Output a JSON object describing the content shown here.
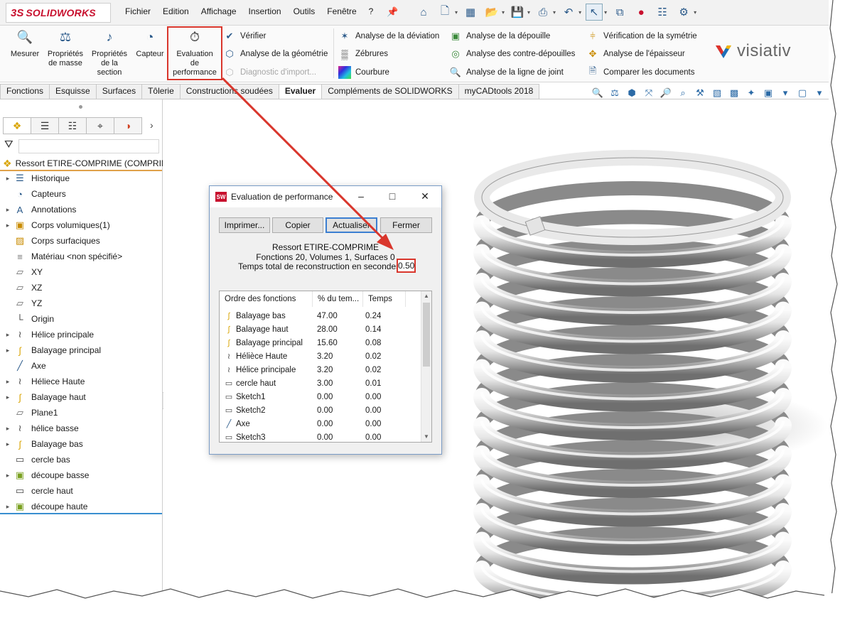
{
  "app": {
    "brand_prefix": "3S",
    "brand": "SOLIDWORKS",
    "menu": [
      "Fichier",
      "Edition",
      "Affichage",
      "Insertion",
      "Outils",
      "Fenêtre",
      "?"
    ]
  },
  "ribbon": {
    "mesurer": [
      "Mesurer"
    ],
    "proprietes_masse": [
      "Propriétés",
      "de masse"
    ],
    "proprietes_section": [
      "Propriétés",
      "de la",
      "section"
    ],
    "capteur": [
      "Capteur"
    ],
    "evaluation": [
      "Evaluation",
      "de",
      "performance"
    ],
    "verifier": "Vérifier",
    "analyse_geometrie": "Analyse de la géométrie",
    "diagnostic": "Diagnostic d'import...",
    "analyse_deviation": "Analyse de la déviation",
    "zebrures": "Zébrures",
    "courbure": "Courbure",
    "analyse_depouille": "Analyse de la dépouille",
    "analyse_contre_depouilles": "Analyse des contre-dépouilles",
    "analyse_ligne_joint": "Analyse de la ligne de joint",
    "verification_symetrie": "Vérification de la symétrie",
    "analyse_epaisseur": "Analyse de l'épaisseur",
    "comparer_documents": "Comparer les documents",
    "visiativ": "visiativ"
  },
  "tabs": [
    "Fonctions",
    "Esquisse",
    "Surfaces",
    "Tôlerie",
    "Constructions soudées",
    "Evaluer",
    "Compléments de SOLIDWORKS",
    "myCADtools 2018"
  ],
  "active_tab": "Evaluer",
  "tree": {
    "root": "Ressort ETIRE-COMPRIME  (COMPRIM",
    "items": [
      {
        "label": "Historique",
        "icon": "history-icon",
        "exp": true
      },
      {
        "label": "Capteurs",
        "icon": "sensor-icon",
        "exp": false
      },
      {
        "label": "Annotations",
        "icon": "annotation-icon",
        "exp": true
      },
      {
        "label": "Corps volumiques(1)",
        "icon": "solid-bodies-icon",
        "exp": true
      },
      {
        "label": "Corps surfaciques",
        "icon": "surface-bodies-icon",
        "exp": false
      },
      {
        "label": "Matériau <non spécifié>",
        "icon": "material-icon",
        "exp": false
      },
      {
        "label": "XY",
        "icon": "plane-icon",
        "exp": false
      },
      {
        "label": "XZ",
        "icon": "plane-icon",
        "exp": false
      },
      {
        "label": "YZ",
        "icon": "plane-icon",
        "exp": false
      },
      {
        "label": "Origin",
        "icon": "origin-icon",
        "exp": false
      },
      {
        "label": "Hélice principale",
        "icon": "helix-icon",
        "exp": true
      },
      {
        "label": "Balayage principal",
        "icon": "sweep-icon",
        "exp": true
      },
      {
        "label": "Axe",
        "icon": "axis-icon",
        "exp": false
      },
      {
        "label": "Héliece Haute",
        "icon": "helix-icon",
        "exp": true
      },
      {
        "label": "Balayage haut",
        "icon": "sweep-icon",
        "exp": true
      },
      {
        "label": "Plane1",
        "icon": "plane-icon",
        "exp": false
      },
      {
        "label": "hélice basse",
        "icon": "helix-icon",
        "exp": true
      },
      {
        "label": "Balayage bas",
        "icon": "sweep-icon",
        "exp": true
      },
      {
        "label": "cercle bas",
        "icon": "sketch-icon",
        "exp": false
      },
      {
        "label": "découpe basse",
        "icon": "cut-icon",
        "exp": true
      },
      {
        "label": "cercle haut",
        "icon": "sketch-icon",
        "exp": false
      },
      {
        "label": "découpe haute",
        "icon": "cut-icon",
        "exp": true
      }
    ]
  },
  "dialog": {
    "title": "Evaluation de performance",
    "buttons": {
      "print": "Imprimer...",
      "copy": "Copier",
      "refresh": "Actualiser",
      "close": "Fermer"
    },
    "model": "Ressort ETIRE-COMPRIME",
    "summary": "Fonctions 20, Volumes 1, Surfaces 0",
    "time_label": "Temps total de reconstruction en secondes:",
    "time_value": "0.50",
    "columns": [
      "Ordre des fonctions",
      "% du tem...",
      "Temps"
    ],
    "rows": [
      {
        "name": "Balayage bas",
        "icon": "sweep-icon",
        "pct": "47.00",
        "time": "0.24"
      },
      {
        "name": "Balayage haut",
        "icon": "sweep-icon",
        "pct": "28.00",
        "time": "0.14"
      },
      {
        "name": "Balayage principal",
        "icon": "sweep-icon",
        "pct": "15.60",
        "time": "0.08"
      },
      {
        "name": "Hélièce Haute",
        "icon": "helix-icon",
        "pct": "3.20",
        "time": "0.02"
      },
      {
        "name": "Hélice principale",
        "icon": "helix-icon",
        "pct": "3.20",
        "time": "0.02"
      },
      {
        "name": "cercle haut",
        "icon": "sketch-icon",
        "pct": "3.00",
        "time": "0.01"
      },
      {
        "name": "Sketch1",
        "icon": "sketch-icon",
        "pct": "0.00",
        "time": "0.00"
      },
      {
        "name": "Sketch2",
        "icon": "sketch-icon",
        "pct": "0.00",
        "time": "0.00"
      },
      {
        "name": "Axe",
        "icon": "axis-icon",
        "pct": "0.00",
        "time": "0.00"
      },
      {
        "name": "Sketch3",
        "icon": "sketch-icon",
        "pct": "0.00",
        "time": "0.00"
      }
    ]
  },
  "colors": {
    "highlight": "#d9362c",
    "accent": "#3a8fd0",
    "brand": "#c8102e"
  }
}
